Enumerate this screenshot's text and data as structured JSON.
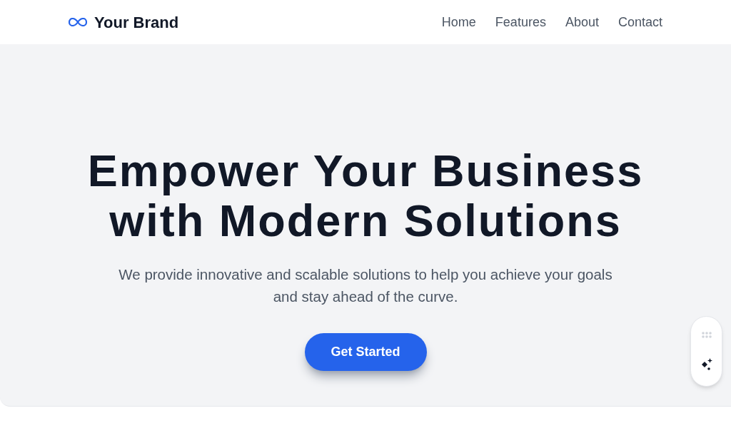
{
  "header": {
    "brand": "Your Brand",
    "nav": [
      {
        "label": "Home"
      },
      {
        "label": "Features"
      },
      {
        "label": "About"
      },
      {
        "label": "Contact"
      }
    ]
  },
  "hero": {
    "title": "Empower Your Business with Modern Solutions",
    "subtitle": "We provide innovative and scalable solutions to help you achieve your goals and stay ahead of the curve.",
    "button": "Get Started"
  }
}
